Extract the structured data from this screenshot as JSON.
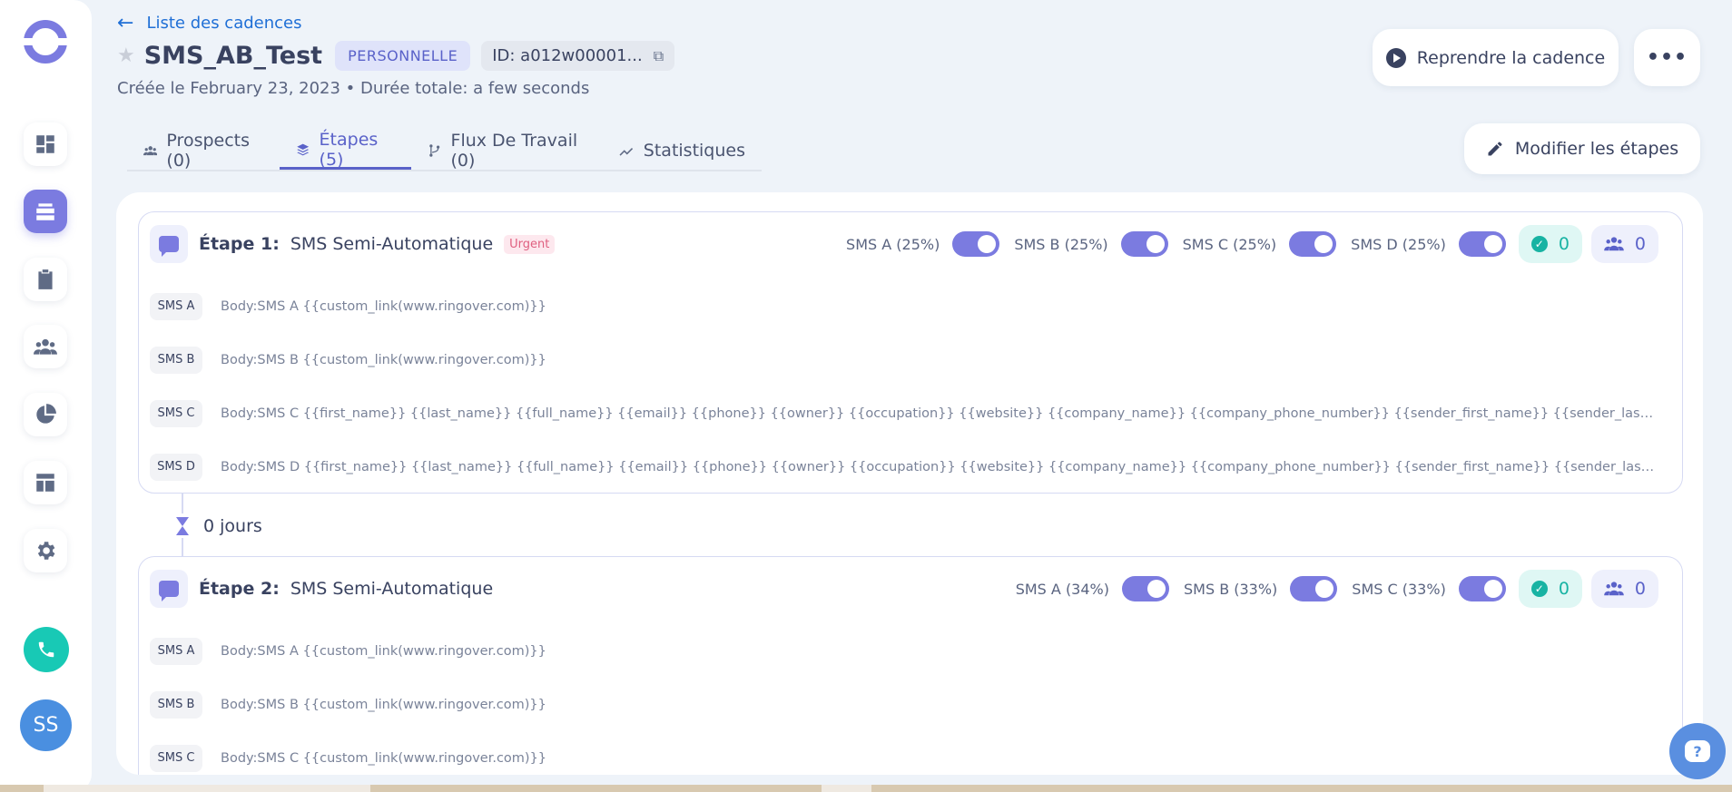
{
  "colors": {
    "accent": "#7b7be0",
    "link": "#1f6fd6",
    "teal": "#18c9b5",
    "urgent": "#e06080"
  },
  "sidebar": {
    "items": [
      {
        "icon": "dashboard-icon"
      },
      {
        "icon": "cadences-icon",
        "active": true
      },
      {
        "icon": "tasks-icon"
      },
      {
        "icon": "people-icon"
      },
      {
        "icon": "pie-chart-icon"
      },
      {
        "icon": "templates-icon"
      },
      {
        "icon": "settings-icon"
      }
    ],
    "avatar": "SS"
  },
  "header": {
    "back_label": "Liste des cadences",
    "title": "SMS_AB_Test",
    "badge": "PERSONNELLE",
    "id_label": "ID: a012w00001...",
    "subline": "Créée le February 23, 2023 • Durée totale: a few seconds",
    "resume_label": "Reprendre la cadence",
    "more_label": "•••",
    "edit_label": "Modifier les étapes"
  },
  "tabs": [
    {
      "label": "Prospects (0)",
      "icon": "people-icon"
    },
    {
      "label": "Étapes (5)",
      "icon": "layers-icon",
      "active": true
    },
    {
      "label": "Flux De Travail (0)",
      "icon": "workflow-icon"
    },
    {
      "label": "Statistiques",
      "icon": "trend-icon"
    }
  ],
  "steps": [
    {
      "label": "Étape 1:",
      "type": "SMS Semi-Automatique",
      "urgent": "Urgent",
      "variants": [
        "SMS A (25%)",
        "SMS B (25%)",
        "SMS C (25%)",
        "SMS D (25%)"
      ],
      "done_count": "0",
      "people_count": "0",
      "rows": [
        {
          "tag": "SMS A",
          "body": "Body:SMS A {{custom_link(www.ringover.com)}}"
        },
        {
          "tag": "SMS B",
          "body": "Body:SMS B {{custom_link(www.ringover.com)}}"
        },
        {
          "tag": "SMS C",
          "body": "Body:SMS C {{first_name}} {{last_name}} {{full_name}} {{email}} {{phone}} {{owner}} {{occupation}} {{website}} {{company_name}} {{company_phone_number}} {{sender_first_name}} {{sender_last_name}} {{sender_name}} {{sender_..."
        },
        {
          "tag": "SMS D",
          "body": "Body:SMS D {{first_name}} {{last_name}} {{full_name}} {{email}} {{phone}} {{owner}} {{occupation}} {{website}} {{company_name}} {{company_phone_number}} {{sender_first_name}} {{sender_last_name}} {{sender_name}} {{sender_..."
        }
      ]
    },
    {
      "label": "Étape 2:",
      "type": "SMS Semi-Automatique",
      "variants": [
        "SMS A (34%)",
        "SMS B (33%)",
        "SMS C (33%)"
      ],
      "done_count": "0",
      "people_count": "0",
      "rows": [
        {
          "tag": "SMS A",
          "body": "Body:SMS A {{custom_link(www.ringover.com)}}"
        },
        {
          "tag": "SMS B",
          "body": "Body:SMS B {{custom_link(www.ringover.com)}}"
        },
        {
          "tag": "SMS C",
          "body": "Body:SMS C {{custom_link(www.ringover.com)}}"
        }
      ]
    }
  ],
  "delay": "0 jours",
  "help_label": "?"
}
